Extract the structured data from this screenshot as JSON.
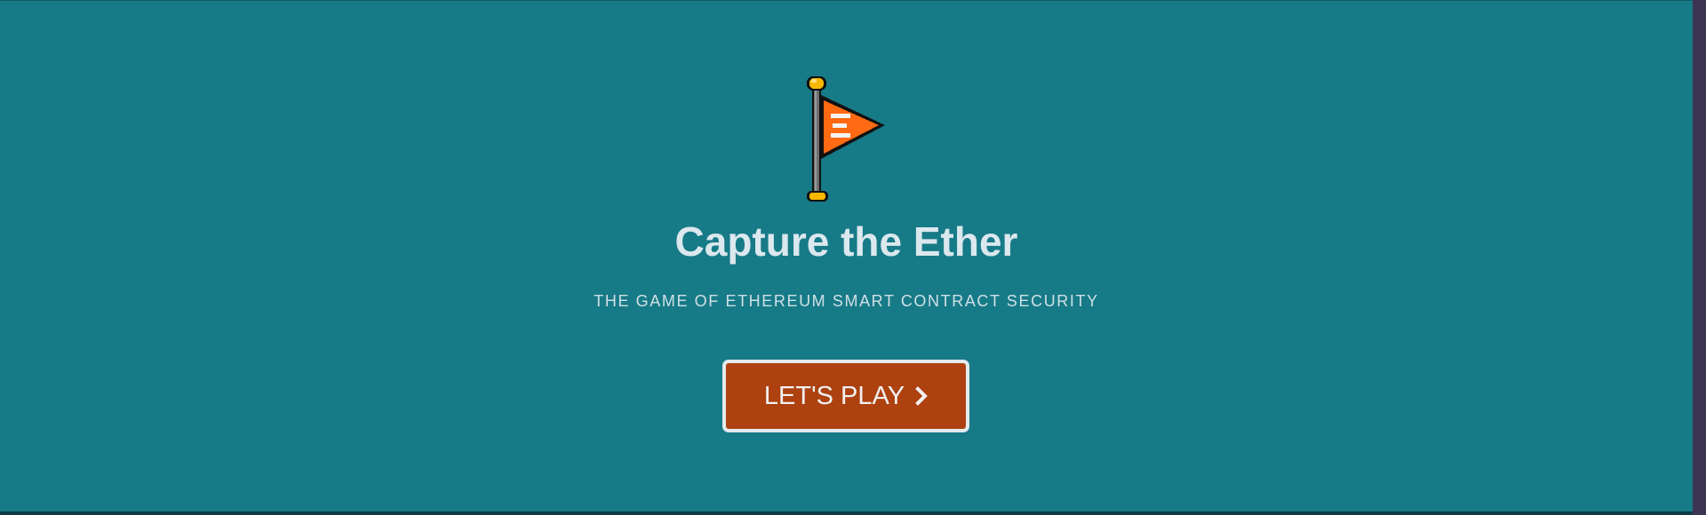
{
  "hero": {
    "title": "Capture the Ether",
    "subtitle": "THE GAME OF ETHEREUM SMART CONTRACT SECURITY",
    "cta_label": "LET'S PLAY",
    "cta_icon": "chevron-right-icon",
    "logo_icon": "flag-icon",
    "logo_glyph": "Ξ"
  },
  "colors": {
    "background": "#177a87",
    "button": "#ad4110",
    "button_border": "#e4eaee",
    "flag": "#ff6a13",
    "pole_cap": "#f9b800",
    "text": "#dbe8ee"
  }
}
